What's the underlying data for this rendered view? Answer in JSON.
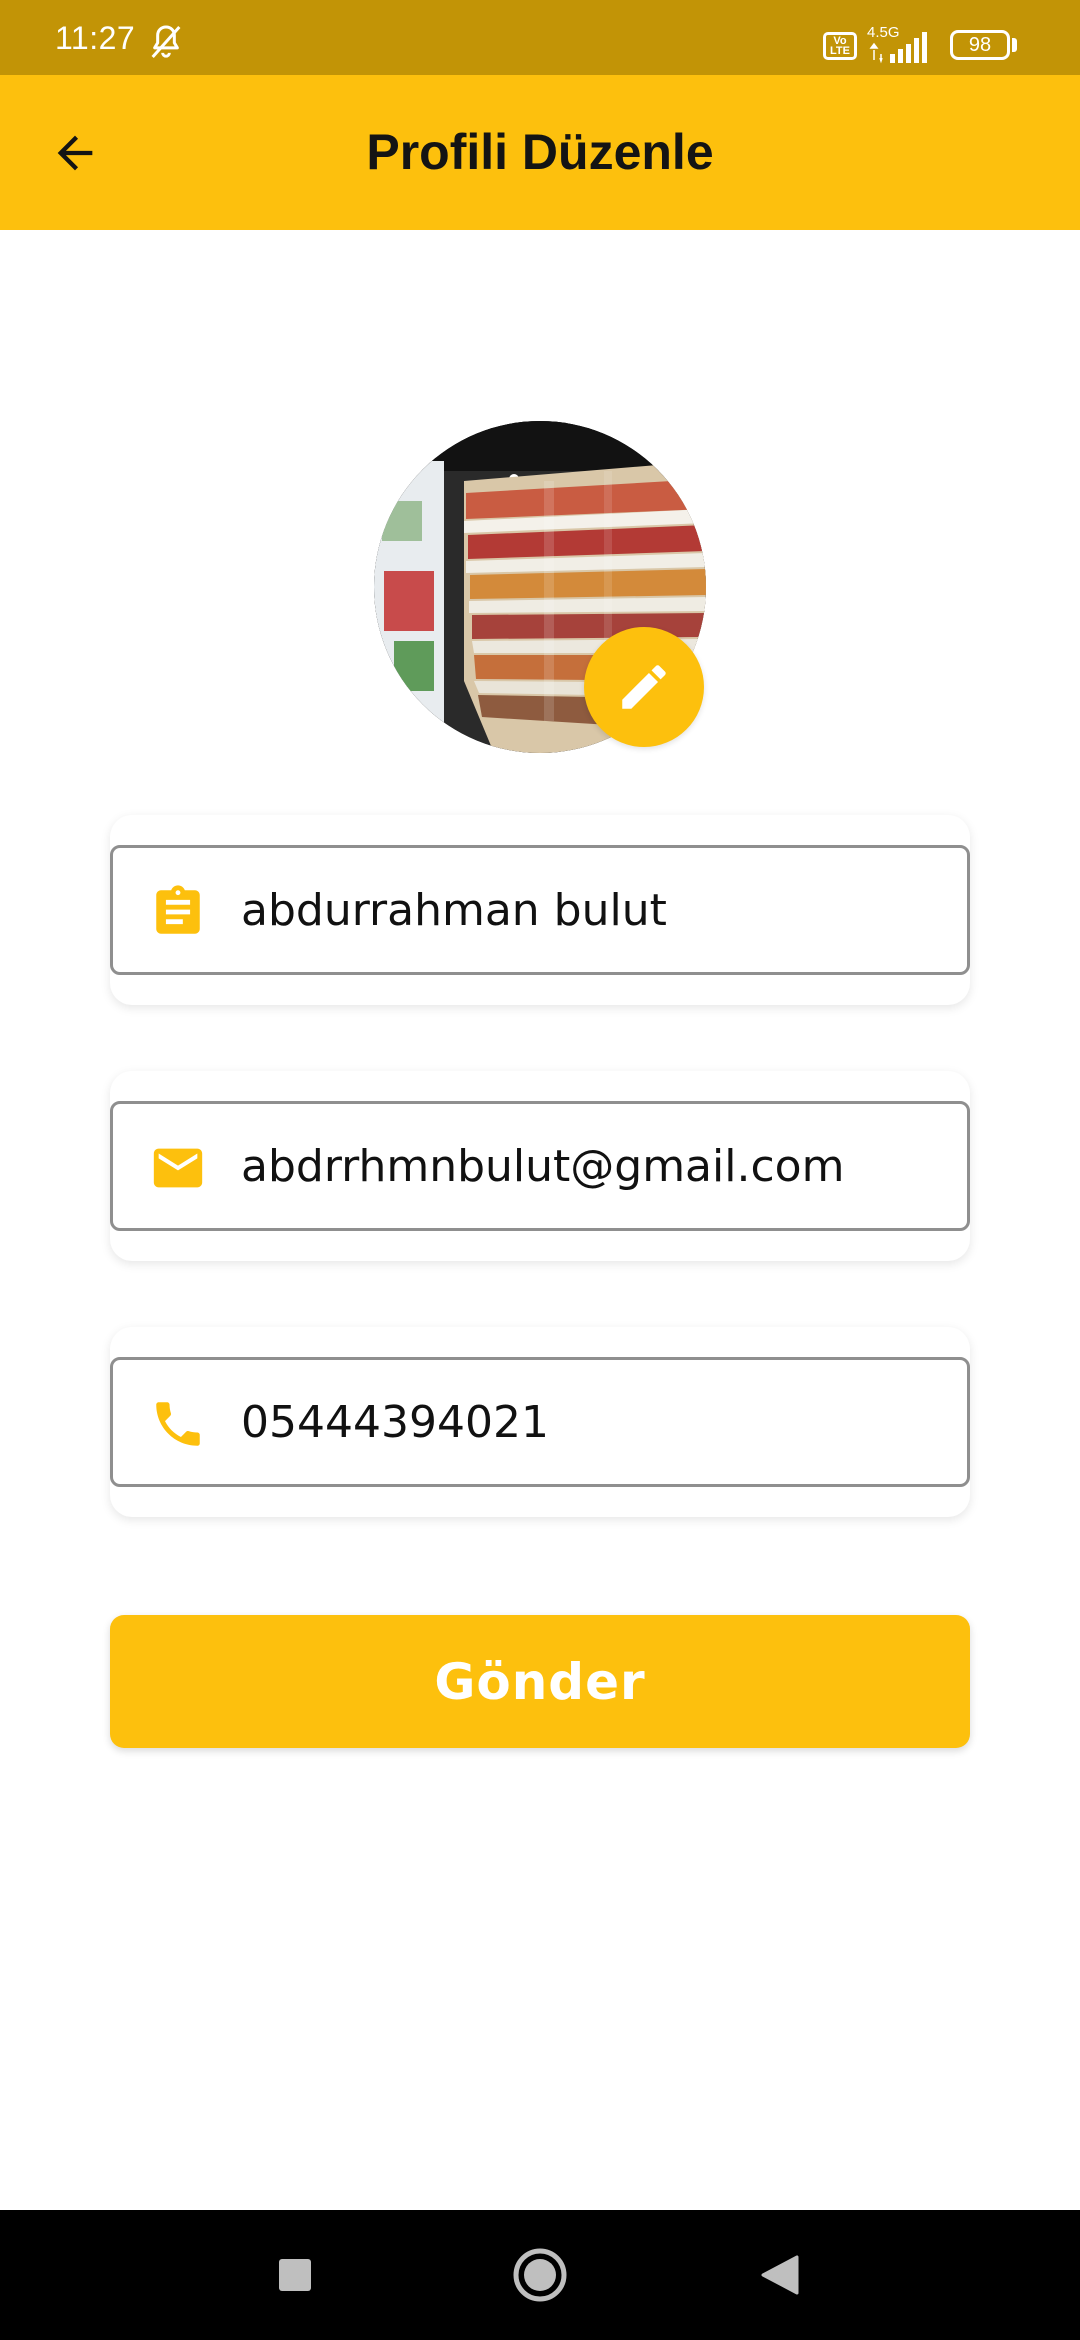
{
  "status_bar": {
    "time": "11:27",
    "volte": "Vo LTE",
    "network": "4.5G",
    "battery": "98",
    "icons": [
      "bell-off-icon",
      "volte-icon",
      "signal-icon",
      "battery-icon"
    ]
  },
  "header": {
    "title": "Profili Düzenle",
    "back_icon": "arrow-back-icon"
  },
  "profile": {
    "avatar": "supermarket-shelves-photo",
    "edit_icon": "pencil-icon"
  },
  "form": {
    "fields": [
      {
        "icon": "clipboard-icon",
        "value": "abdurrahman bulut"
      },
      {
        "icon": "mail-icon",
        "value": "abdrrhmnbulut@gmail.com"
      },
      {
        "icon": "phone-icon",
        "value": "05444394021"
      }
    ],
    "submit_label": "Gönder"
  },
  "colors": {
    "status_bar": "#c29406",
    "accent": "#fdc00d",
    "title_text": "#141414",
    "field_border": "#8f8f8f",
    "nav_bar": "#000000"
  },
  "nav_bar": {
    "icons": [
      "recents-square-icon",
      "home-circle-icon",
      "back-triangle-icon"
    ]
  }
}
